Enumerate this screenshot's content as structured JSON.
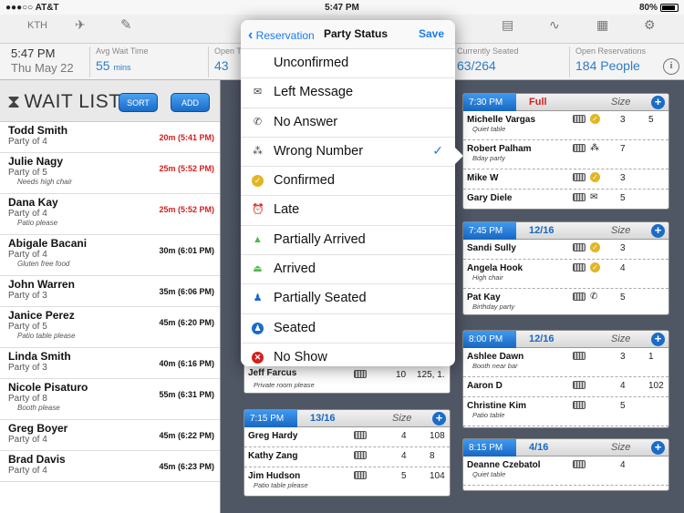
{
  "status_bar": {
    "carrier": "●●●○○ AT&T",
    "time": "5:47 PM",
    "battery": "80%"
  },
  "toolbar_icons": [
    "kth-icon",
    "airplane-icon",
    "edit-icon",
    "contact-card-icon",
    "waveform-icon",
    "calendar-icon",
    "settings-icon"
  ],
  "stats": {
    "time": "5:47 PM",
    "date": "Thu May 22",
    "avg_wait_label": "Avg Wait Time",
    "avg_wait_value": "55",
    "avg_wait_unit": "mins",
    "open_label": "Open T",
    "open_value": "43",
    "seated_label": "Currently Seated",
    "seated_value": "63/264",
    "reservations_label": "Open Reservations",
    "reservations_value": "184 People"
  },
  "waitlist": {
    "title": "WAIT LIST",
    "sort_label": "SORT",
    "add_label": "ADD",
    "items": [
      {
        "name": "Todd Smith",
        "party": "Party of 4",
        "note": "",
        "time": "20m (5:41 PM)"
      },
      {
        "name": "Julie Nagy",
        "party": "Party of 5",
        "note": "Needs high chair",
        "time": "25m (5:52 PM)"
      },
      {
        "name": "Dana Kay",
        "party": "Party of 4",
        "note": "Patio please",
        "time": "25m (5:52 PM)"
      },
      {
        "name": "Abigale Bacani",
        "party": "Party of 4",
        "note": "Gluten free food",
        "time": "30m (6:01 PM)"
      },
      {
        "name": "John Warren",
        "party": "Party of 3",
        "note": "",
        "time": "35m (6:06 PM)"
      },
      {
        "name": "Janice Perez",
        "party": "Party of 5",
        "note": "Patio table please",
        "time": "45m (6:20 PM)"
      },
      {
        "name": "Linda Smith",
        "party": "Party of 3",
        "note": "",
        "time": "40m (6:16 PM)"
      },
      {
        "name": "Nicole Pisaturo",
        "party": "Party of 8",
        "note": "Booth please",
        "time": "55m (6:31 PM)"
      },
      {
        "name": "Greg Boyer",
        "party": "Party of 4",
        "note": "",
        "time": "45m (6:22 PM)"
      },
      {
        "name": "Brad Davis",
        "party": "Party of 4",
        "note": "",
        "time": "45m (6:23 PM)"
      }
    ]
  },
  "popover": {
    "back_label": "Reservation",
    "title": "Party Status",
    "save_label": "Save",
    "options": [
      {
        "label": "Unconfirmed",
        "icon": "none"
      },
      {
        "label": "Left Message",
        "icon": "envelope-icon",
        "glyph": "✉"
      },
      {
        "label": "No Answer",
        "icon": "no-phone-icon",
        "glyph": "✆"
      },
      {
        "label": "Wrong Number",
        "icon": "wrong-number-icon",
        "glyph": "⁂",
        "selected": true
      },
      {
        "label": "Confirmed",
        "icon": "confirmed-icon",
        "glyph": "✓"
      },
      {
        "label": "Late",
        "icon": "alarm-clock-icon",
        "glyph": "⏰"
      },
      {
        "label": "Partially Arrived",
        "icon": "car-icon",
        "glyph": "▲"
      },
      {
        "label": "Arrived",
        "icon": "arrived-icon",
        "glyph": "⏏"
      },
      {
        "label": "Partially Seated",
        "icon": "partially-seated-icon",
        "glyph": "♟"
      },
      {
        "label": "Seated",
        "icon": "seated-icon",
        "glyph": "♟"
      },
      {
        "label": "No Show",
        "icon": "no-show-icon",
        "glyph": "✕"
      }
    ]
  },
  "middle_cards": {
    "card_a_rows": [
      {
        "name": "Jeff Farcus",
        "note": "Private room please",
        "size": "10",
        "table": "125, 1."
      }
    ],
    "card_b": {
      "time": "7:15 PM",
      "count": "13/16",
      "size_label": "Size",
      "rows": [
        {
          "name": "Greg Hardy",
          "note": "",
          "size": "4",
          "table": "108"
        },
        {
          "name": "Kathy Zang",
          "note": "",
          "size": "4",
          "table": "8"
        },
        {
          "name": "Jim Hudson",
          "note": "Patio table please",
          "size": "5",
          "table": "104"
        }
      ]
    }
  },
  "right_cards": [
    {
      "time": "7:30 PM",
      "count": "Full",
      "full": true,
      "size_label": "Size",
      "rows": [
        {
          "name": "Michelle Vargas",
          "note": "Quiet table",
          "status": "confirmed",
          "size": "3",
          "table": "5"
        },
        {
          "name": "Robert Palham",
          "note": "Bday party",
          "status": "wrong-number",
          "size": "7",
          "table": ""
        },
        {
          "name": "Mike W",
          "note": "",
          "status": "confirmed",
          "size": "3",
          "table": ""
        },
        {
          "name": "Gary Diele",
          "note": "",
          "status": "left-message",
          "size": "5",
          "table": ""
        }
      ]
    },
    {
      "time": "7:45 PM",
      "count": "12/16",
      "full": false,
      "size_label": "Size",
      "rows": [
        {
          "name": "Sandi Sully",
          "note": "",
          "status": "confirmed",
          "size": "3",
          "table": ""
        },
        {
          "name": "Angela Hook",
          "note": "High chair",
          "status": "confirmed",
          "size": "4",
          "table": ""
        },
        {
          "name": "Pat Kay",
          "note": "Birthday party",
          "status": "no-answer",
          "size": "5",
          "table": ""
        }
      ]
    },
    {
      "time": "8:00 PM",
      "count": "12/16",
      "full": false,
      "size_label": "Size",
      "rows": [
        {
          "name": "Ashlee Dawn",
          "note": "Booth near bar",
          "status": "",
          "size": "3",
          "table": "1"
        },
        {
          "name": "Aaron D",
          "note": "",
          "status": "",
          "size": "4",
          "table": "102"
        },
        {
          "name": "Christine Kim",
          "note": "Patio table",
          "status": "",
          "size": "5",
          "table": ""
        }
      ]
    },
    {
      "time": "8:15 PM",
      "count": "4/16",
      "full": false,
      "size_label": "Size",
      "rows": [
        {
          "name": "Deanne Czebatol",
          "note": "Quiet table",
          "status": "",
          "size": "4",
          "table": ""
        }
      ]
    }
  ],
  "colors": {
    "accent": "#1a7cf0",
    "late": "#d31f1f",
    "confirmed": "#e2b623",
    "background": "#4f5664"
  }
}
